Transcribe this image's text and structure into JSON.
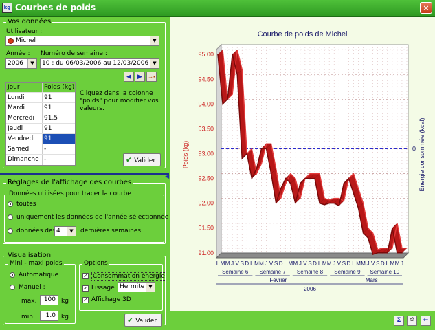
{
  "window": {
    "title": "Courbes de poids",
    "icon": "scale-icon",
    "close": "×"
  },
  "donnees": {
    "group_label": "Vos données",
    "user_label": "Utilisateur :",
    "user_value": "Michel",
    "year_label": "Année :",
    "year_value": "2006",
    "week_label": "Numéro de semaine :",
    "week_value": "10 : du 06/03/2006 au 12/03/2006",
    "table_headers": [
      "Jour",
      "Poids (kg)"
    ],
    "rows": [
      {
        "day": "Lundi",
        "weight": "91"
      },
      {
        "day": "Mardi",
        "weight": "91"
      },
      {
        "day": "Mercredi",
        "weight": "91.5"
      },
      {
        "day": "Jeudi",
        "weight": "91"
      },
      {
        "day": "Vendredi",
        "weight": "91"
      },
      {
        "day": "Samedi",
        "weight": "-"
      },
      {
        "day": "Dimanche",
        "weight": "-"
      }
    ],
    "hint": "Cliquez dans la colonne \"poids\" pour modifier vos valeurs.",
    "validate": "Valider"
  },
  "reglages": {
    "group_label": "Réglages de l'affichage des courbes",
    "data_label": "Données utilisées pour tracer la courbe",
    "opt_all": "toutes",
    "opt_year": "uniquement les données de l'année sélectionnée",
    "opt_last_prefix": "données des",
    "opt_last_value": "4",
    "opt_last_suffix": "dernières semaines"
  },
  "visualisation": {
    "group_label": "Visualisation",
    "minmax_label": "Mini - maxi poids",
    "auto": "Automatique",
    "manual": "Manuel :",
    "max_label": "max.",
    "max_value": "100",
    "min_label": "min.",
    "min_value": "1.0",
    "unit": "kg",
    "options_label": "Options",
    "opt_energy": "Consommation énergie",
    "opt_smooth": "Lissage",
    "smooth_value": "Hermite",
    "opt_3d": "Affichage 3D",
    "validate": "Valider"
  },
  "chart_data": {
    "type": "line",
    "title": "Courbe de poids de Michel",
    "ylabel": "Poids (kg)",
    "y2label": "Energie consommée (kcal)",
    "y2_tick": "0",
    "ylim": [
      90.9,
      95.1
    ],
    "yticks": [
      "95.00",
      "94.50",
      "94.00",
      "93.50",
      "93.00",
      "92.50",
      "92.00",
      "91.50",
      "91.00"
    ],
    "color": "#cc1f1f",
    "day_letters": [
      "L",
      "M",
      "M",
      "J",
      "V",
      "S",
      "D"
    ],
    "weeks": [
      "Semaine 6",
      "Semaine 7",
      "Semaine 8",
      "Semaine 9",
      "Semaine 10"
    ],
    "months": [
      "Février",
      "Mars"
    ],
    "year": "2006",
    "values": [
      95.0,
      94.0,
      94.1,
      95.0,
      94.6,
      92.9,
      93.0,
      92.5,
      92.7,
      93.1,
      93.1,
      92.6,
      92.0,
      92.3,
      92.5,
      92.4,
      92.0,
      92.4,
      92.5,
      92.5,
      92.5,
      92.0,
      91.97,
      92.0,
      92.0,
      91.95,
      92.4,
      92.5,
      92.2,
      91.9,
      91.4,
      91.3,
      90.97,
      91.0,
      91.0,
      91.0,
      91.5,
      91.0,
      91.0
    ]
  },
  "footer": {
    "icons": [
      "export-icon",
      "print-icon",
      "back-icon"
    ]
  }
}
